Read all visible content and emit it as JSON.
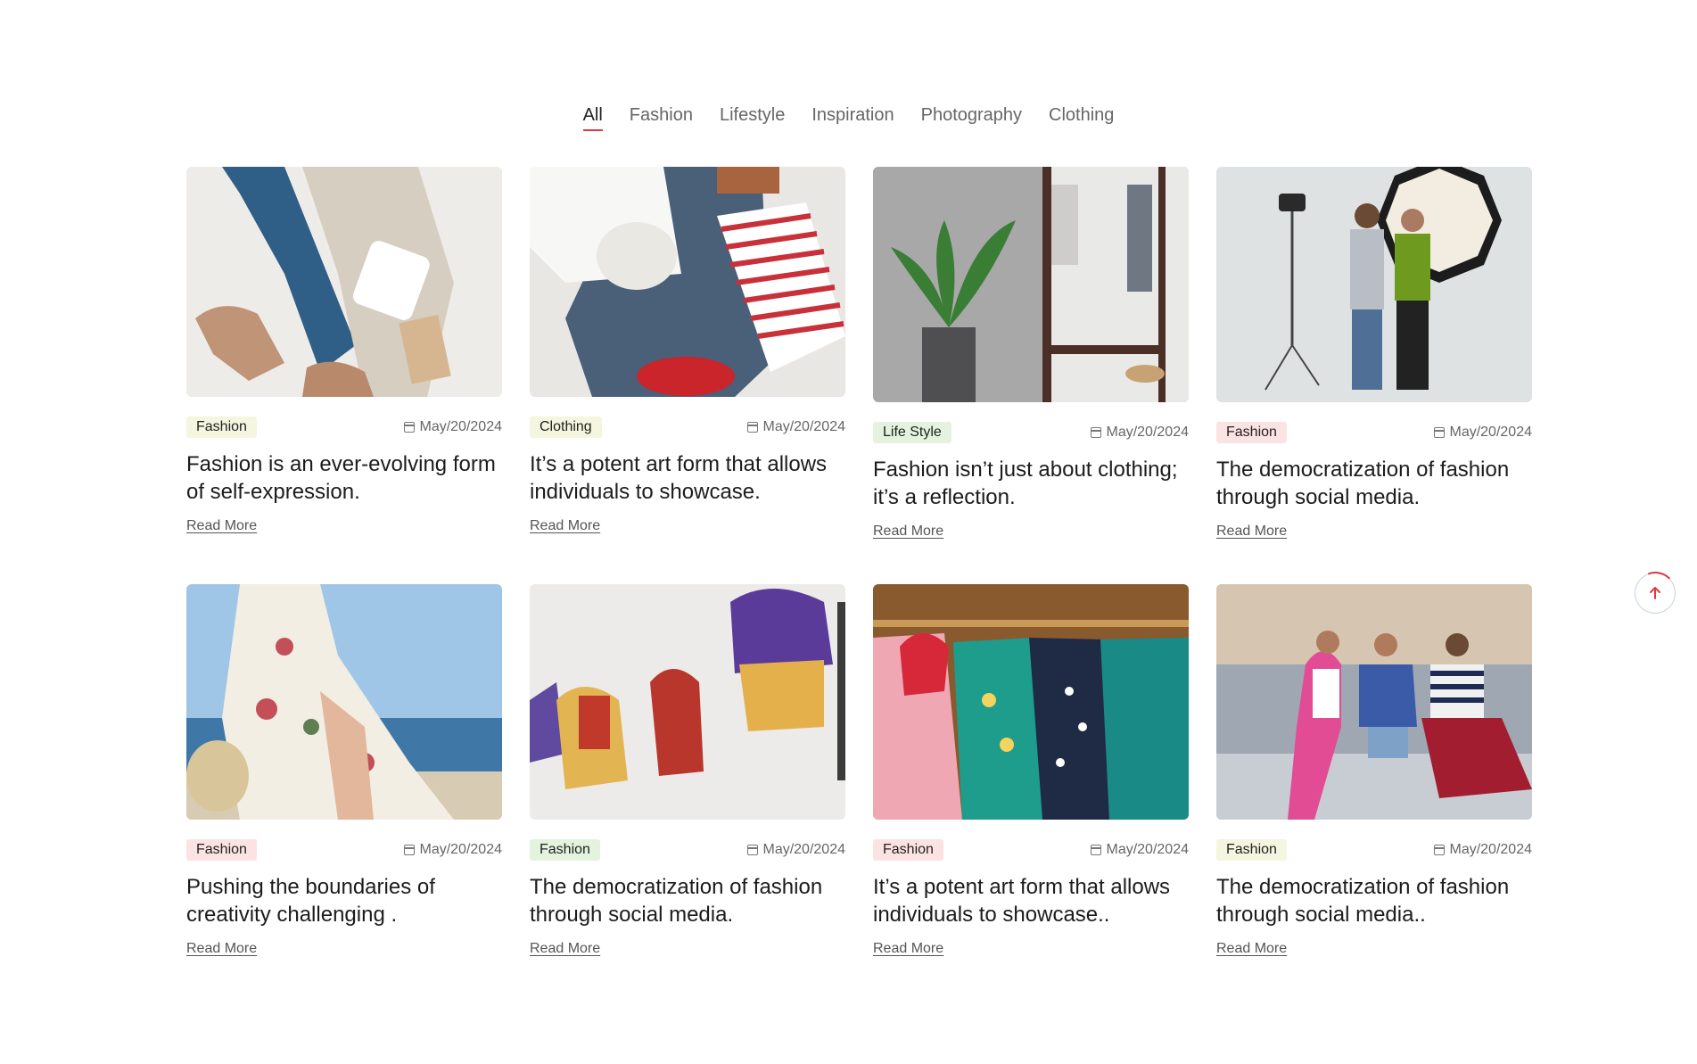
{
  "filters": [
    "All",
    "Fashion",
    "Lifestyle",
    "Inspiration",
    "Photography",
    "Clothing"
  ],
  "active_filter": "All",
  "posts": [
    {
      "tag": "Fashion",
      "tag_color": "#f4f6df",
      "date": "May/20/2024",
      "title": "Fashion is an ever-evolving form of self-expression.",
      "more": "Read More",
      "image": "flat-lay-sweater-jeans-boots"
    },
    {
      "tag": "Clothing",
      "tag_color": "#f4f6df",
      "date": "May/20/2024",
      "title": "It’s a potent art form that allows individuals to showcase.",
      "more": "Read More",
      "image": "flat-lay-denim-striped-tote"
    },
    {
      "tag": "Life Style",
      "tag_color": "#e3f3dd",
      "date": "May/20/2024",
      "title": "Fashion isn’t just about clothing; it’s a reflection.",
      "more": "Read More",
      "image": "plant-and-clothing-rack"
    },
    {
      "tag": "Fashion",
      "tag_color": "#fbe3e3",
      "date": "May/20/2024",
      "title": "The democratization of fashion through social media.",
      "more": "Read More",
      "image": "photographer-couple-studio"
    },
    {
      "tag": "Fashion",
      "tag_color": "#fbe3e3",
      "date": "May/20/2024",
      "title": "Pushing the boundaries of creativity challenging .",
      "more": "Read More",
      "image": "floral-dress-by-sea"
    },
    {
      "tag": "Fashion",
      "tag_color": "#e3f3dd",
      "date": "May/20/2024",
      "title": "The democratization of fashion through social media.",
      "more": "Read More",
      "image": "hanging-jackets"
    },
    {
      "tag": "Fashion",
      "tag_color": "#fbe3e3",
      "date": "May/20/2024",
      "title": "It’s a potent art form that allows individuals to showcase..",
      "more": "Read More",
      "image": "colorful-shirts-rack"
    },
    {
      "tag": "Fashion",
      "tag_color": "#f4f6df",
      "date": "May/20/2024",
      "title": "The democratization of fashion through social media..",
      "more": "Read More",
      "image": "three-women-boardwalk"
    }
  ],
  "icons": {
    "date": "calendar-icon",
    "scroll_top": "arrow-up-icon"
  },
  "accent": "#e0393e"
}
